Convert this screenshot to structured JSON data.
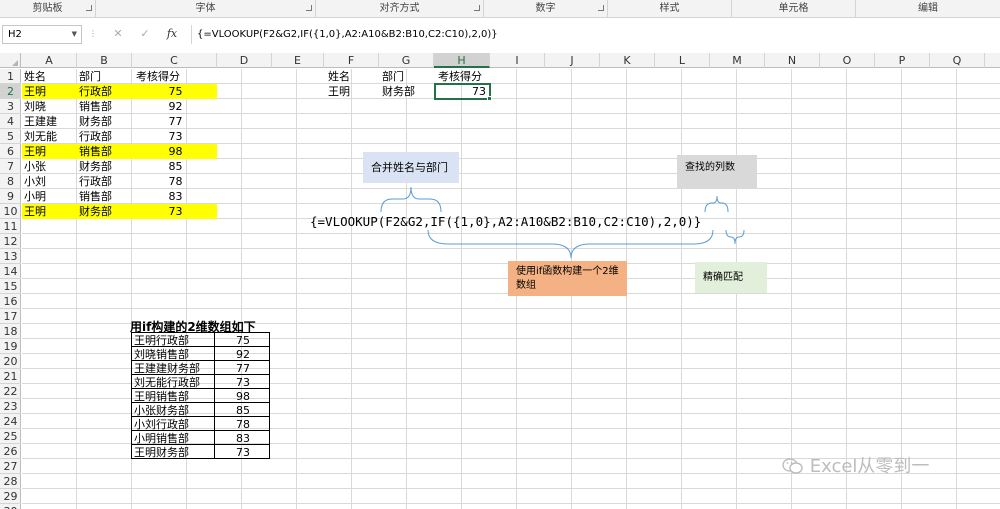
{
  "ribbon": {
    "groups": [
      "剪贴板",
      "字体",
      "对齐方式",
      "数字",
      "样式",
      "单元格",
      "编辑"
    ]
  },
  "formula_bar": {
    "name_box": "H2",
    "fx": "fx",
    "formula": "{=VLOOKUP(F2&G2,IF({1,0},A2:A10&B2:B10,C2:C10),2,0)}"
  },
  "columns": [
    "A",
    "B",
    "C",
    "D",
    "E",
    "F",
    "G",
    "H",
    "I",
    "J",
    "K",
    "L",
    "M",
    "N",
    "O",
    "P",
    "Q"
  ],
  "selected_column": "H",
  "rows": [
    "1",
    "2",
    "3",
    "4",
    "5",
    "6",
    "7",
    "8",
    "9",
    "10",
    "11",
    "12",
    "13",
    "14",
    "15",
    "16",
    "17",
    "18",
    "19",
    "20",
    "21",
    "22",
    "23",
    "24",
    "25",
    "26",
    "27",
    "28",
    "29",
    "30"
  ],
  "selected_row": "2",
  "source_table": {
    "headers": [
      "姓名",
      "部门",
      "考核得分"
    ],
    "rows": [
      {
        "name": "王明",
        "dept": "行政部",
        "score": "75",
        "highlight": true
      },
      {
        "name": "刘晓",
        "dept": "销售部",
        "score": "92",
        "highlight": false
      },
      {
        "name": "王建建",
        "dept": "财务部",
        "score": "77",
        "highlight": false
      },
      {
        "name": "刘无能",
        "dept": "行政部",
        "score": "73",
        "highlight": false
      },
      {
        "name": "王明",
        "dept": "销售部",
        "score": "98",
        "highlight": true
      },
      {
        "name": "小张",
        "dept": "财务部",
        "score": "85",
        "highlight": false
      },
      {
        "name": "小刘",
        "dept": "行政部",
        "score": "78",
        "highlight": false
      },
      {
        "name": "小明",
        "dept": "销售部",
        "score": "83",
        "highlight": false
      },
      {
        "name": "王明",
        "dept": "财务部",
        "score": "73",
        "highlight": true
      }
    ],
    "highlight_color": "#ffff00"
  },
  "lookup": {
    "headers": [
      "姓名",
      "部门",
      "考核得分"
    ],
    "name": "王明",
    "dept": "财务部",
    "result": "73"
  },
  "annotations": {
    "formula": "{=VLOOKUP(F2&G2,IF({1,0},A2:A10&B2:B10,C2:C10),2,0)}",
    "merge_note": "合并姓名与部门",
    "column_note": "查找的列数",
    "if_note": "使用if函数构建一个2维数组",
    "exact_note": "精确匹配",
    "colors": {
      "merge_box": "#dae3f3",
      "column_box": "#d9d9d9",
      "if_box": "#f4b183",
      "exact_box": "#e2efda",
      "brace": "#5b9bd5"
    }
  },
  "array_table": {
    "title": "用if构建的2维数组如下",
    "rows": [
      {
        "key": "王明行政部",
        "value": "75"
      },
      {
        "key": "刘晓销售部",
        "value": "92"
      },
      {
        "key": "王建建财务部",
        "value": "77"
      },
      {
        "key": "刘无能行政部",
        "value": "73"
      },
      {
        "key": "王明销售部",
        "value": "98"
      },
      {
        "key": "小张财务部",
        "value": "85"
      },
      {
        "key": "小刘行政部",
        "value": "78"
      },
      {
        "key": "小明销售部",
        "value": "83"
      },
      {
        "key": "王明财务部",
        "value": "73"
      }
    ]
  },
  "watermark": "Excel从零到一"
}
